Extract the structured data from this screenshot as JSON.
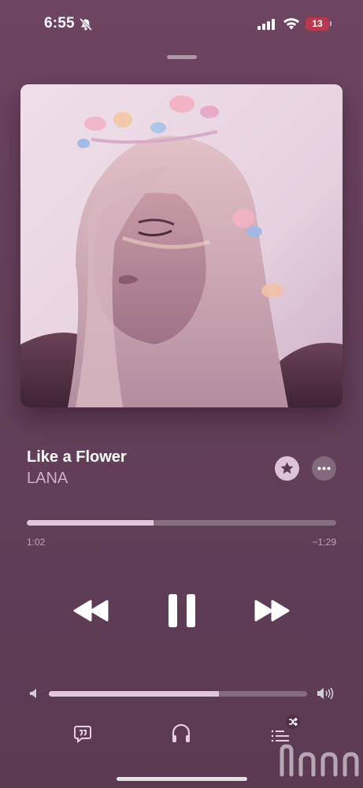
{
  "status_bar": {
    "time": "6:55",
    "battery_level": "13",
    "icons": [
      "bell-slash-icon",
      "cellular-signal-icon",
      "wifi-icon",
      "battery-icon"
    ],
    "battery_color": "#b8384f"
  },
  "now_playing": {
    "title": "Like a Flower",
    "artist": "LANA",
    "artwork_icon": "album-artwork",
    "progress_fraction": 0.41,
    "elapsed": "1:02",
    "remaining": "−1:29"
  },
  "controls": {
    "icons": [
      "rewind-icon",
      "pause-icon",
      "fast-forward-icon"
    ]
  },
  "volume": {
    "level_fraction": 0.66,
    "icons": [
      "volume-low-icon",
      "volume-high-icon"
    ]
  },
  "bottom_bar": {
    "icons": [
      "lyrics-icon",
      "airpods-icon",
      "queue-shuffle-icon"
    ]
  },
  "colors": {
    "background": "#64405a",
    "accent": "#e2c6dc",
    "artist_text": "#d2aecb"
  }
}
